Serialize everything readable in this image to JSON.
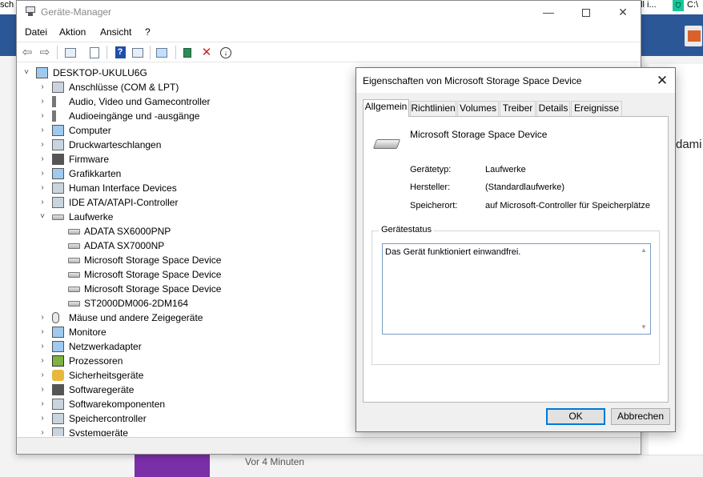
{
  "background": {
    "top_left_fragment": "sch",
    "top_mid_fragment": "ell i...",
    "top_right_fragment": "C:\\",
    "right_word": "dami",
    "time_text": "Vor 4 Minuten"
  },
  "device_manager": {
    "title": "Geräte-Manager",
    "window_controls": {
      "minimize": "—",
      "maximize": "",
      "close": "✕"
    },
    "menu": [
      "Datei",
      "Aktion",
      "Ansicht",
      "?"
    ],
    "toolbar": {
      "back": "⇦",
      "forward": "⇨",
      "help": "?",
      "remove": "✕",
      "update": "↓"
    },
    "root": "DESKTOP-UKULU6G",
    "tree": [
      {
        "label": "Anschlüsse (COM & LPT)",
        "icon": "port-icon",
        "state": "collapsed"
      },
      {
        "label": "Audio, Video und Gamecontroller",
        "icon": "speaker-icon",
        "state": "collapsed"
      },
      {
        "label": "Audioeingänge und -ausgänge",
        "icon": "speaker-icon",
        "state": "collapsed"
      },
      {
        "label": "Computer",
        "icon": "computer-icon",
        "state": "collapsed"
      },
      {
        "label": "Druckwarteschlangen",
        "icon": "printer-icon",
        "state": "collapsed"
      },
      {
        "label": "Firmware",
        "icon": "firmware-icon",
        "state": "collapsed"
      },
      {
        "label": "Grafikkarten",
        "icon": "display-adapter-icon",
        "state": "collapsed"
      },
      {
        "label": "Human Interface Devices",
        "icon": "hid-icon",
        "state": "collapsed"
      },
      {
        "label": "IDE ATA/ATAPI-Controller",
        "icon": "ide-controller-icon",
        "state": "collapsed"
      },
      {
        "label": "Laufwerke",
        "icon": "drive-icon",
        "state": "expanded"
      },
      {
        "label": "ADATA SX6000PNP",
        "icon": "drive-icon",
        "state": "child"
      },
      {
        "label": "ADATA SX7000NP",
        "icon": "drive-icon",
        "state": "child"
      },
      {
        "label": "Microsoft Storage Space Device",
        "icon": "drive-icon",
        "state": "child"
      },
      {
        "label": "Microsoft Storage Space Device",
        "icon": "drive-icon",
        "state": "child"
      },
      {
        "label": "Microsoft Storage Space Device",
        "icon": "drive-icon",
        "state": "child"
      },
      {
        "label": "ST2000DM006-2DM164",
        "icon": "drive-icon",
        "state": "child"
      },
      {
        "label": "Mäuse und andere Zeigegeräte",
        "icon": "mouse-icon",
        "state": "collapsed"
      },
      {
        "label": "Monitore",
        "icon": "monitor-icon",
        "state": "collapsed"
      },
      {
        "label": "Netzwerkadapter",
        "icon": "network-icon",
        "state": "collapsed"
      },
      {
        "label": "Prozessoren",
        "icon": "processor-icon",
        "state": "collapsed"
      },
      {
        "label": "Sicherheitsgeräte",
        "icon": "key-icon",
        "state": "collapsed"
      },
      {
        "label": "Softwaregeräte",
        "icon": "software-device-icon",
        "state": "collapsed"
      },
      {
        "label": "Softwarekomponenten",
        "icon": "software-component-icon",
        "state": "collapsed"
      },
      {
        "label": "Speichercontroller",
        "icon": "storage-controller-icon",
        "state": "collapsed"
      },
      {
        "label": "Systemgeräte",
        "icon": "system-device-icon",
        "state": "collapsed"
      }
    ]
  },
  "properties_dialog": {
    "title": "Eigenschaften von Microsoft Storage Space Device",
    "close": "✕",
    "tabs": [
      "Allgemein",
      "Richtlinien",
      "Volumes",
      "Treiber",
      "Details",
      "Ereignisse"
    ],
    "active_tab": "Allgemein",
    "device_name": "Microsoft Storage Space Device",
    "properties": [
      {
        "label": "Gerätetyp:",
        "value": "Laufwerke"
      },
      {
        "label": "Hersteller:",
        "value": "(Standardlaufwerke)"
      },
      {
        "label": "Speicherort:",
        "value": "auf Microsoft-Controller für Speicherplätze"
      }
    ],
    "status_group_title": "Gerätestatus",
    "status_text": "Das Gerät funktioniert einwandfrei.",
    "ok_label": "OK",
    "cancel_label": "Abbrechen"
  }
}
